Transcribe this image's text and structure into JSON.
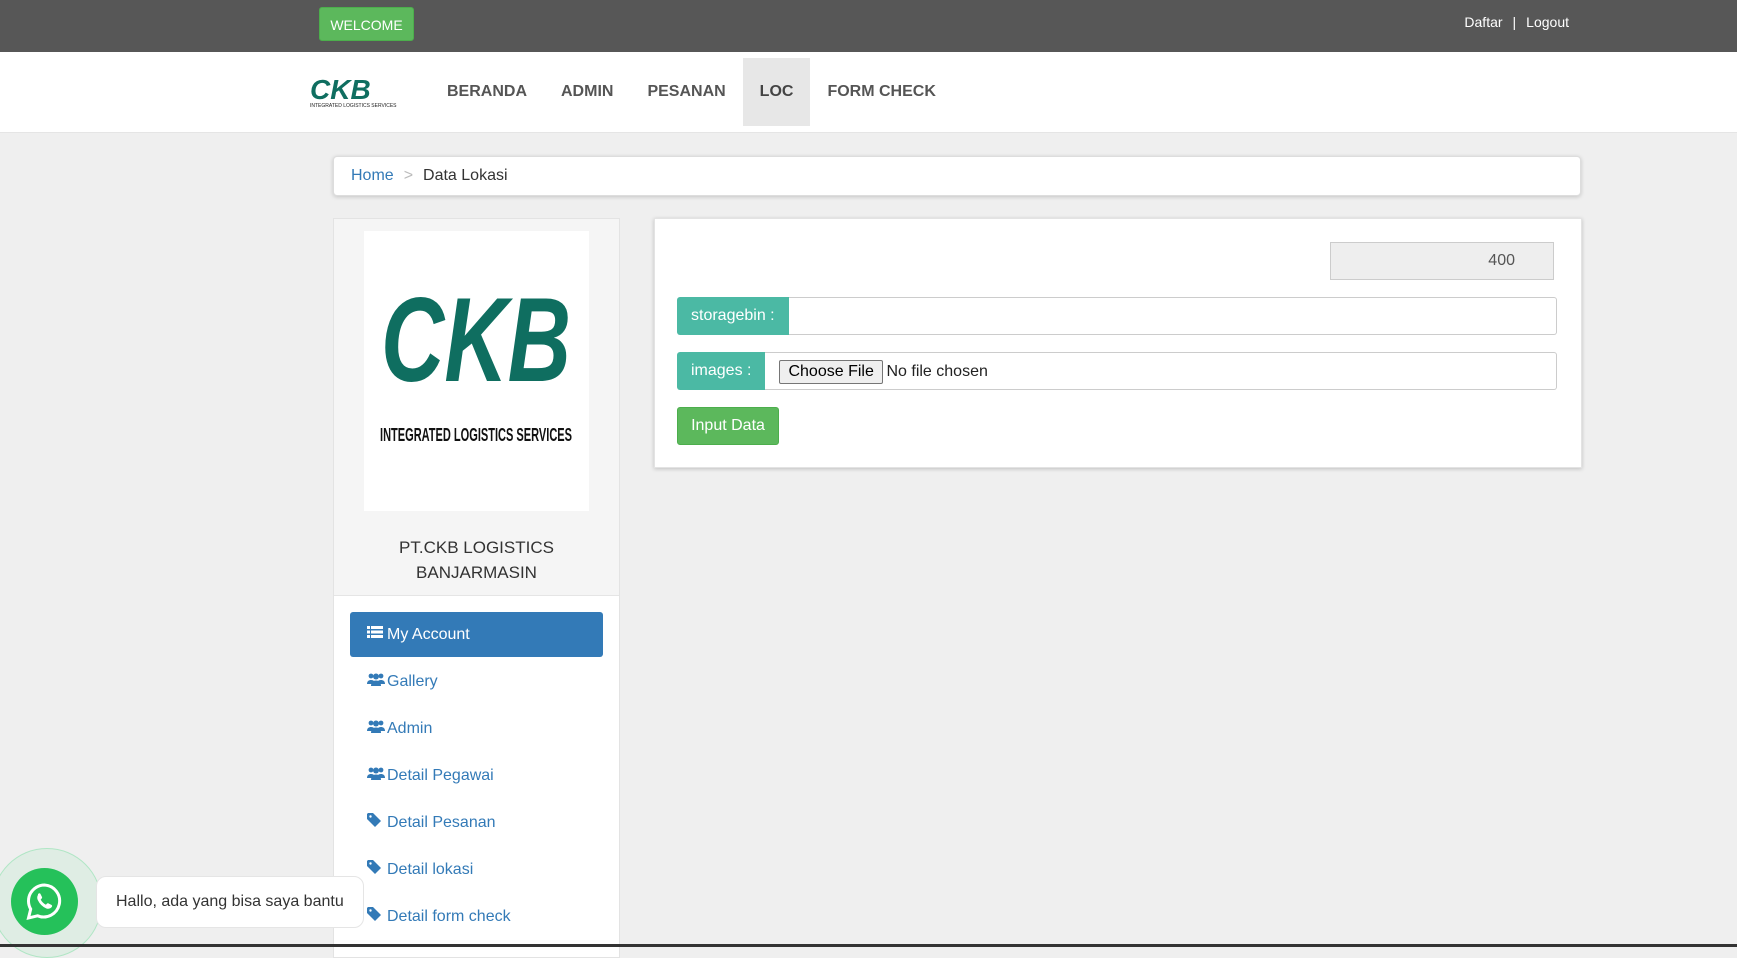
{
  "topbar": {
    "welcome_label": "WELCOME",
    "daftar_label": "Daftar",
    "separator": "|",
    "logout_label": "Logout"
  },
  "brand": {
    "logo_text": "CKB",
    "logo_sub": "INTEGRATED LOGISTICS SERVICES"
  },
  "nav": {
    "items": [
      {
        "label": "BERANDA"
      },
      {
        "label": "ADMIN"
      },
      {
        "label": "PESANAN"
      },
      {
        "label": "LOC",
        "active": true
      },
      {
        "label": "FORM CHECK"
      }
    ]
  },
  "breadcrumb": {
    "home": "Home",
    "divider": ">",
    "current": "Data Lokasi"
  },
  "sidebar": {
    "logo_text": "CKB",
    "logo_sub": "INTEGRATED LOGISTICS SERVICES",
    "company_line1": "PT.CKB LOGISTICS",
    "company_line2": "BANJARMASIN",
    "items": [
      {
        "label": "My Account",
        "icon": "list-icon"
      },
      {
        "label": "Gallery",
        "icon": "users-icon"
      },
      {
        "label": "Admin",
        "icon": "users-icon"
      },
      {
        "label": "Detail Pegawai",
        "icon": "users-icon"
      },
      {
        "label": "Detail Pesanan",
        "icon": "tag-icon"
      },
      {
        "label": "Detail lokasi",
        "icon": "tag-icon"
      },
      {
        "label": "Detail form check",
        "icon": "tag-icon"
      }
    ]
  },
  "form": {
    "number_value": "400",
    "storagebin_label": "storagebin :",
    "storagebin_value": "",
    "images_label": "images :",
    "choose_file_label": "Choose File",
    "no_file_text": "No file chosen",
    "submit_label": "Input Data"
  },
  "whatsapp": {
    "message": "Hallo, ada yang bisa saya bantu"
  },
  "colors": {
    "topbar": "#575757",
    "success": "#5cb85c",
    "primary": "#337ab7",
    "addon": "#4bb9a4",
    "brand_green": "#0f6e60",
    "whatsapp": "#25c15a"
  }
}
